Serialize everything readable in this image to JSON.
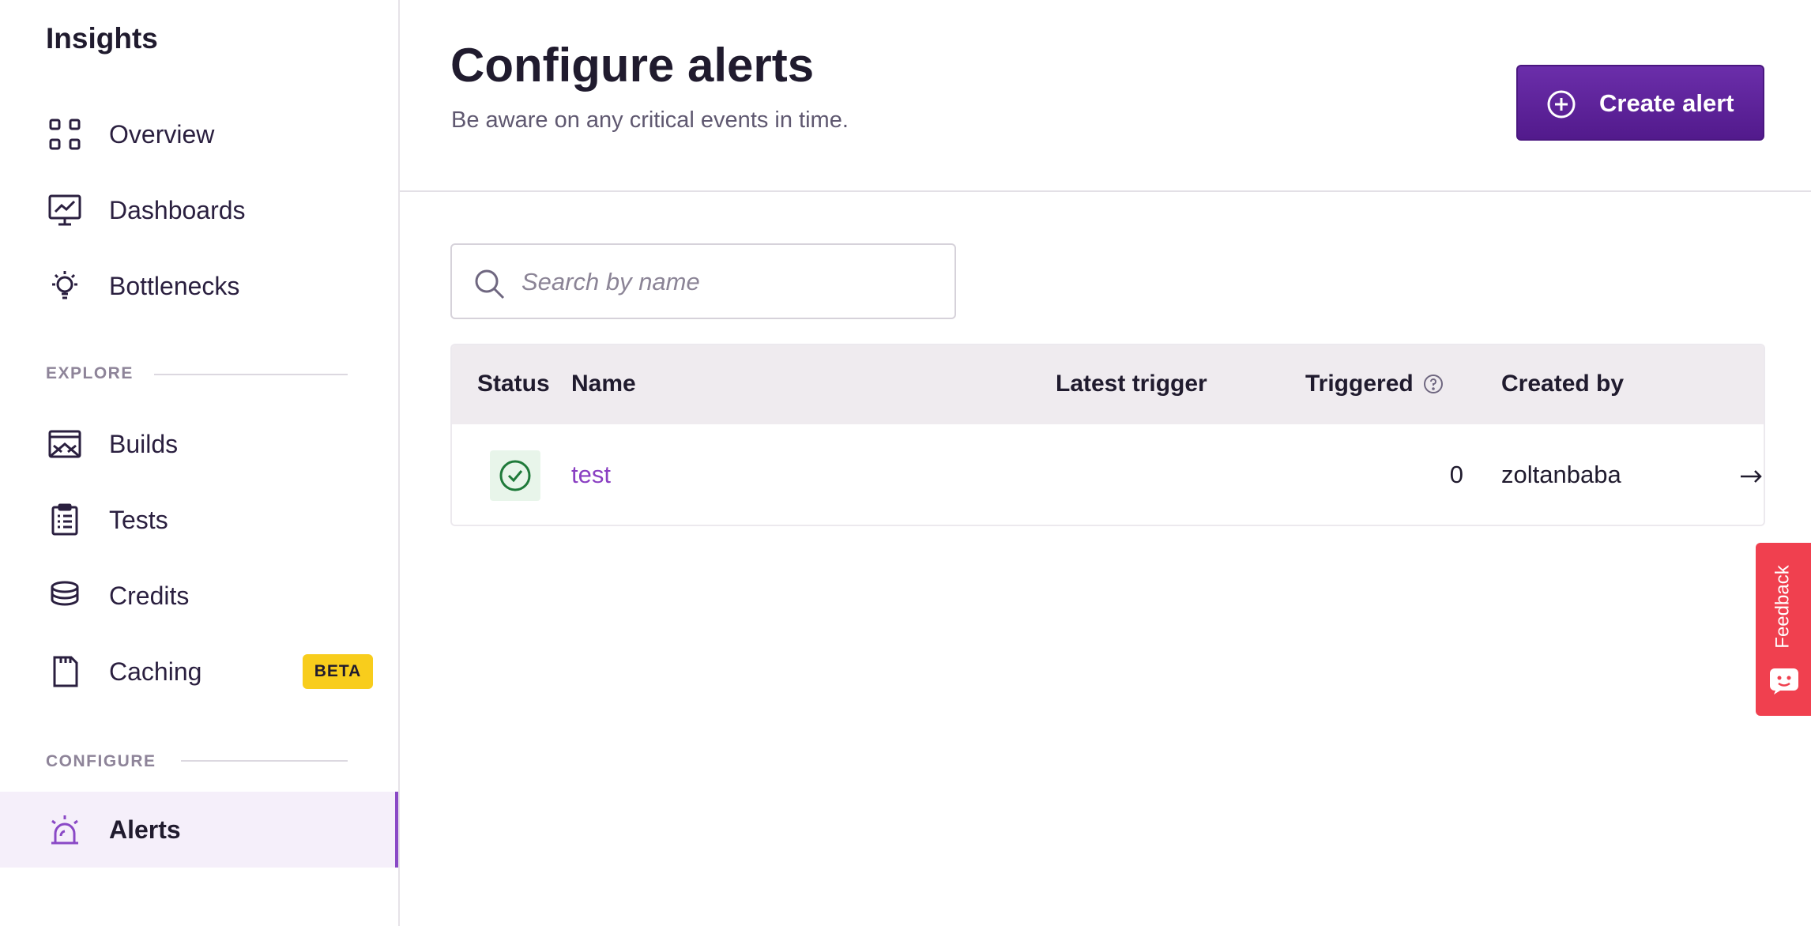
{
  "sidebar": {
    "title": "Insights",
    "items": [
      {
        "label": "Overview",
        "icon": "grid-icon"
      },
      {
        "label": "Dashboards",
        "icon": "chart-monitor-icon"
      },
      {
        "label": "Bottlenecks",
        "icon": "lightbulb-icon"
      },
      {
        "label": "Builds",
        "icon": "builds-icon"
      },
      {
        "label": "Tests",
        "icon": "clipboard-icon"
      },
      {
        "label": "Credits",
        "icon": "coins-stack-icon"
      },
      {
        "label": "Caching",
        "icon": "sd-card-icon",
        "badge": "BETA"
      },
      {
        "label": "Alerts",
        "icon": "siren-icon",
        "active": true
      }
    ],
    "sections": {
      "explore": "EXPLORE",
      "configure": "CONFIGURE"
    }
  },
  "header": {
    "title": "Configure alerts",
    "subtitle": "Be aware on any critical events in time.",
    "create_button": "Create alert"
  },
  "search": {
    "placeholder": "Search by name",
    "value": ""
  },
  "table": {
    "columns": [
      "Status",
      "Name",
      "Latest trigger",
      "Triggered",
      "Created by"
    ],
    "rows": [
      {
        "status": "ok",
        "name": "test",
        "latest_trigger": "",
        "triggered": "0",
        "created_by": "zoltanbaba"
      }
    ]
  },
  "feedback": {
    "label": "Feedback"
  },
  "colors": {
    "accent": "#6b2eaa",
    "link": "#8a3fc2",
    "beta": "#f8cd1c",
    "feedback": "#f0404f",
    "status_ok": "#1f7a3a"
  }
}
